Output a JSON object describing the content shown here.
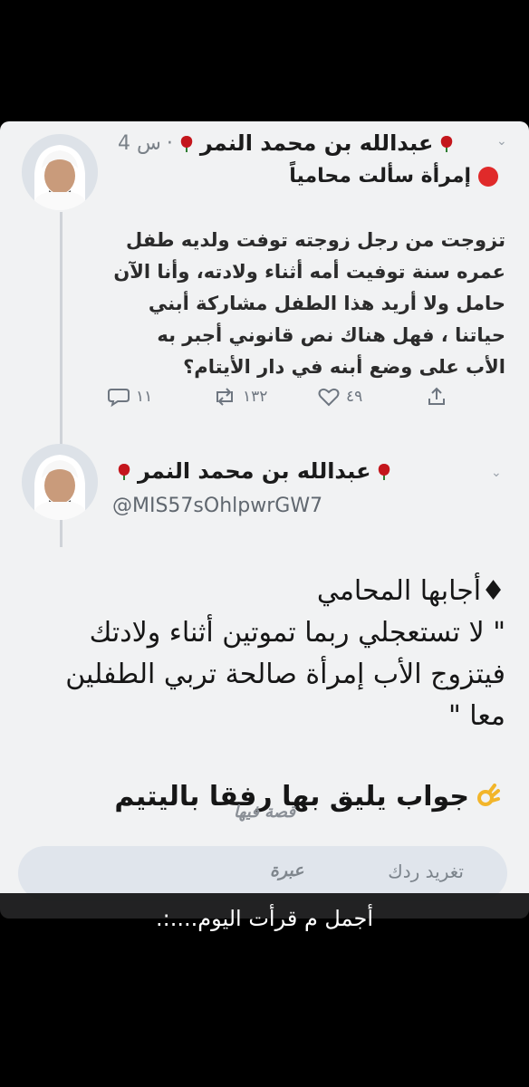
{
  "tweet1": {
    "author": "عبدالله بن محمد النمر",
    "time": "4 س",
    "headline": "إمرأة سألت محامياً",
    "body_lines": [
      "تزوجت من رجل زوجته توفت ولديه طفل",
      "عمره سنة توفيت أمه أثناء ولادته، وأنا الآن",
      "حامل ولا أريد هذا الطفل مشاركة أبني",
      "حياتنا ، فهل هناك نص قانوني أجبر به",
      "الأب على وضع أبنه في دار الأيتام؟"
    ],
    "actions": {
      "replies": "١١",
      "retweets": "١٣٢",
      "likes": "٤٩"
    }
  },
  "tweet2": {
    "author": "عبدالله بن محمد النمر",
    "handle": "@MIS57sOhlpwrGW7",
    "reply_lines": [
      "♦أجابها المحامي",
      "\" لا تستعجلي ربما تموتين أثناء ولادتك",
      "فيتزوج الأب إمرأة صالحة تربي الطفلين",
      "معا \""
    ],
    "verdict": "جواب يليق بها رفقا باليتيم"
  },
  "watermark": {
    "top": "قصة فيها",
    "bottom": "عبرة"
  },
  "compose": {
    "placeholder": "تغريد ردك"
  },
  "caption": "أجمل م قرأت اليوم....:.",
  "colors": {
    "rose": "#c4161c",
    "alert_dot": "#e02a2a",
    "card_bg": "#f1f2f3",
    "page_bg": "#000000"
  }
}
